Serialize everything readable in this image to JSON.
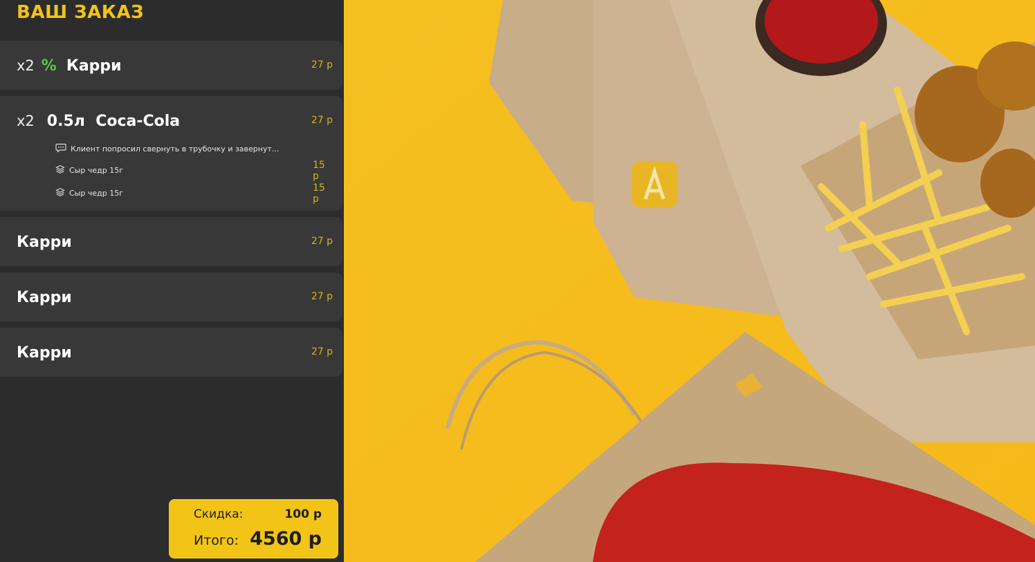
{
  "header": {
    "title": "ВАШ ЗАКАЗ"
  },
  "items": [
    {
      "qty": "x2",
      "discount": "%",
      "name": "Карри",
      "price": "27 р"
    },
    {
      "qty": "x2",
      "name": "0.5л  Coca-Cola",
      "price": "27 р",
      "comment": "Клиент попросил свернуть в трубочку и завернут...",
      "comment_icon": "chat-bubble-icon",
      "addons": [
        {
          "icon": "layers-icon",
          "label": "Сыр чедр 15г",
          "price": "15 р"
        },
        {
          "icon": "layers-icon",
          "label": "Сыр чедр 15г",
          "price": "15 р"
        }
      ]
    },
    {
      "name": "Карри",
      "price": "27 р"
    },
    {
      "name": "Карри",
      "price": "27 р"
    },
    {
      "name": "Карри",
      "price": "27 р"
    }
  ],
  "summary": {
    "discount_label": "Скидка:",
    "discount_value": "100 р",
    "total_label": "Итого:",
    "total_value": "4560 р"
  },
  "colors": {
    "accent": "#f2c418",
    "panel_bg": "#2c2c2c",
    "card_bg": "#383838",
    "discount_green": "#62c14a",
    "price_gold": "#d6b41a"
  }
}
